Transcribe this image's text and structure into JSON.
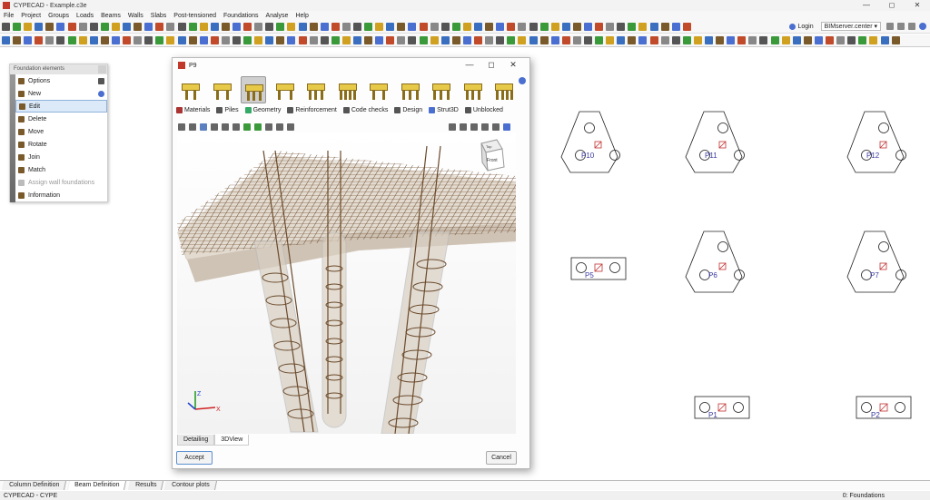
{
  "window": {
    "title": "CYPECAD - Example.c3e",
    "controls": [
      "—",
      "◻",
      "✕"
    ]
  },
  "menu": [
    "File",
    "Project",
    "Groups",
    "Loads",
    "Beams",
    "Walls",
    "Slabs",
    "Post-tensioned",
    "Foundations",
    "Analyse",
    "Help"
  ],
  "account": {
    "login": "Login",
    "server": "BIMserver.center ▾"
  },
  "panel": {
    "title": "Foundation elements",
    "items": [
      {
        "label": "Options"
      },
      {
        "label": "New"
      },
      {
        "label": "Edit"
      },
      {
        "label": "Delete"
      },
      {
        "label": "Move"
      },
      {
        "label": "Rotate"
      },
      {
        "label": "Join"
      },
      {
        "label": "Match"
      },
      {
        "label": "Assign wall foundations"
      },
      {
        "label": "Information"
      }
    ]
  },
  "dialog": {
    "title": "P9",
    "tabs": [
      "Materials",
      "Piles",
      "Geometry",
      "Reinforcement",
      "Code checks",
      "Design",
      "Strut3D",
      "Unblocked"
    ],
    "view_tabs": [
      "Detailing",
      "3DView"
    ],
    "accept": "Accept",
    "cancel": "Cancel",
    "viewcube": {
      "top": "Top",
      "front": "Front"
    },
    "axes": {
      "x": "X",
      "z": "Z"
    }
  },
  "plan": {
    "labels": [
      "P10",
      "P11",
      "P12",
      "P5",
      "P6",
      "P7",
      "P1",
      "P2"
    ]
  },
  "sheet_tabs": [
    "Column Definition",
    "Beam Definition",
    "Results",
    "Contour plots"
  ],
  "status": {
    "left": "CYPECAD - CYPE",
    "right": "0: Foundations"
  },
  "colors": {
    "cap": "#e7c94a",
    "rebar": "#6b4a2b",
    "accent": "#c0392b"
  }
}
